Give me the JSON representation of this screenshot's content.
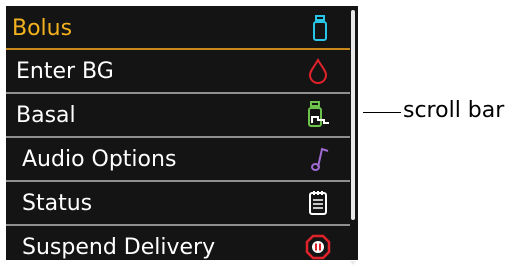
{
  "menu": {
    "items": [
      {
        "label": "Bolus",
        "icon": "insulin-cartridge-icon",
        "selected": true
      },
      {
        "label": "Enter BG",
        "icon": "blood-drop-icon"
      },
      {
        "label": "Basal",
        "icon": "basal-profile-icon"
      },
      {
        "label": "Audio Options",
        "icon": "music-note-icon"
      },
      {
        "label": "Status",
        "icon": "status-clipboard-icon"
      },
      {
        "label": "Suspend Delivery",
        "icon": "pause-octagon-icon"
      }
    ]
  },
  "annotation": {
    "scroll_bar_label": "scroll bar"
  },
  "colors": {
    "background": "#141414",
    "selected_text": "#f2b21e",
    "selected_rule": "#c8891a",
    "divider": "#8f8f8f",
    "bolus_icon": "#29c6e8",
    "bg_icon": "#e0222a",
    "basal_icon": "#6cc24a",
    "audio_icon": "#a06bd2",
    "status_icon": "#ffffff",
    "suspend_icon": "#e0222a"
  }
}
